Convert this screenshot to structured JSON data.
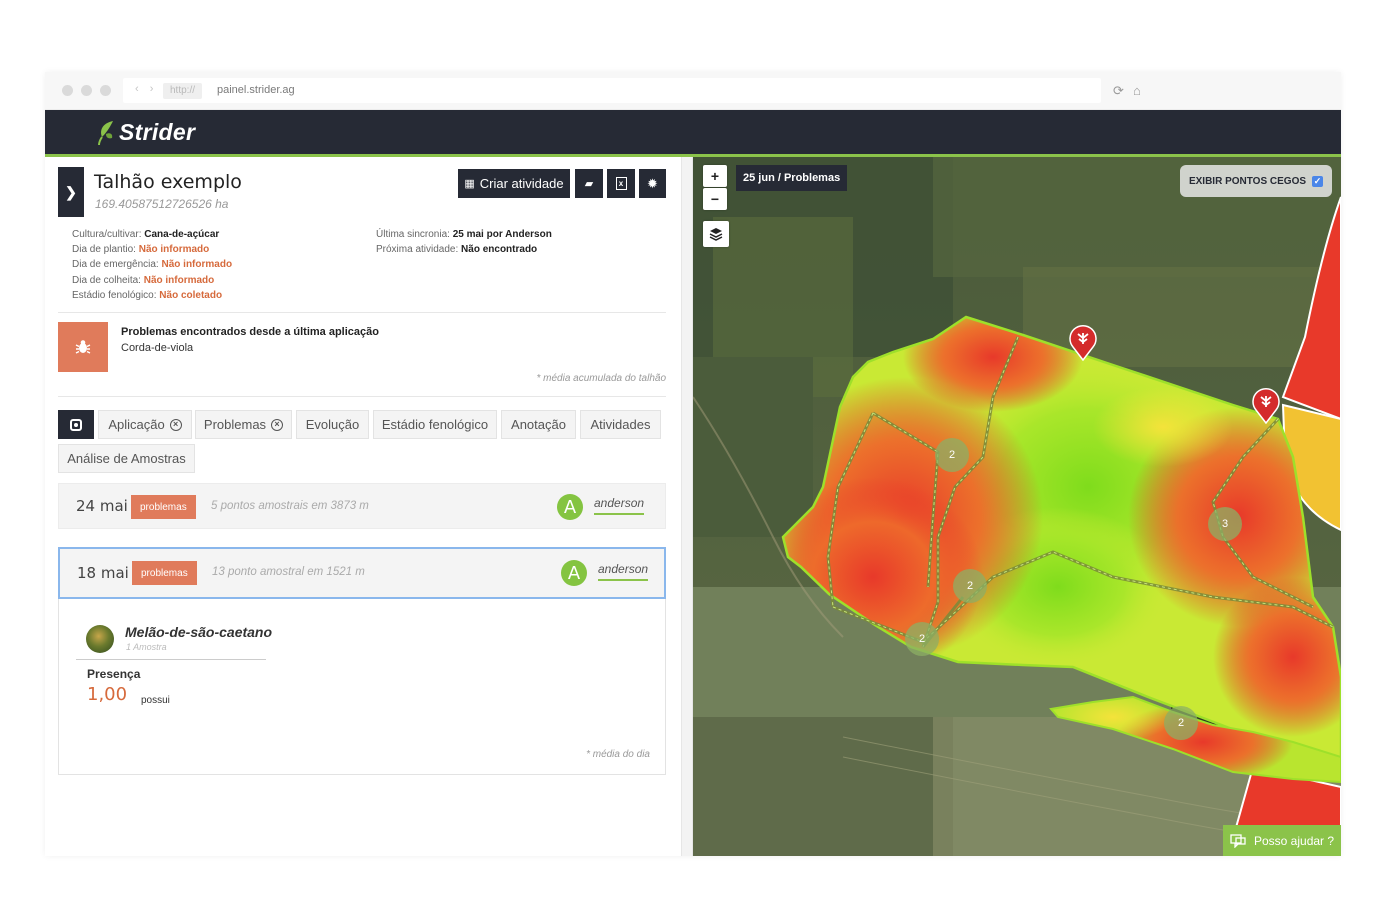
{
  "browser": {
    "http_label": "http://",
    "url": "painel.strider.ag"
  },
  "app": {
    "logo_text": "Strider"
  },
  "field": {
    "title": "Talhão exemplo",
    "area": "169.40587512726526 ha",
    "create_activity_label": "Criar atividade"
  },
  "props_left": [
    {
      "label": "Cultura/cultivar:",
      "value": "Cana-de-açúcar",
      "style": "b"
    },
    {
      "label": "Dia de plantio:",
      "value": "Não informado",
      "style": "red"
    },
    {
      "label": "Dia de emergência:",
      "value": "Não informado",
      "style": "red"
    },
    {
      "label": "Dia de colheita:",
      "value": "Não informado",
      "style": "red"
    },
    {
      "label": "Estádio fenológico:",
      "value": "Não coletado",
      "style": "red"
    }
  ],
  "props_right": [
    {
      "label": "Última sincronia:",
      "value": "25 mai por Anderson"
    },
    {
      "label": "Próxima atividade:",
      "value": "Não encontrado"
    }
  ],
  "problems": {
    "title": "Problemas encontrados desde a última aplicação",
    "item": "Corda-de-viola",
    "note": "* média acumulada do talhão"
  },
  "tabs": {
    "aplicacao": "Aplicação",
    "problemas": "Problemas",
    "evolucao": "Evolução",
    "estadio": "Estádio fenológico",
    "anotacao": "Anotação",
    "atividades": "Atividades",
    "analise": "Análise de Amostras"
  },
  "records": [
    {
      "date": "24 mai",
      "badge": "problemas",
      "info": "5 pontos amostrais em 3873 m",
      "avatar": "A",
      "user": "anderson"
    },
    {
      "date": "18 mai",
      "badge": "problemas",
      "info": "13 ponto amostral em 1521 m",
      "avatar": "A",
      "user": "anderson"
    }
  ],
  "detail": {
    "weed_name": "Melão-de-são-caetano",
    "samples": "1 Amostra",
    "metric_label": "Presença",
    "metric_value": "1,00",
    "metric_unit": "possui",
    "note": "* média do dia"
  },
  "map": {
    "zoom_in": "+",
    "zoom_out": "−",
    "label": "25 jun / Problemas",
    "blind_spots_label": "EXIBIR PONTOS CEGOS",
    "blind_spots_checked": true,
    "clusters": [
      "2",
      "2",
      "2",
      "3",
      "2"
    ],
    "help_label": "Posso ajudar ?"
  },
  "colors": {
    "header_bg": "#262a35",
    "accent_green": "#8bc34a",
    "problem_badge": "#e07b5b",
    "heat_red": "#e8392a",
    "heat_yellow": "#f2e13a",
    "heat_green": "#8fe02a"
  }
}
